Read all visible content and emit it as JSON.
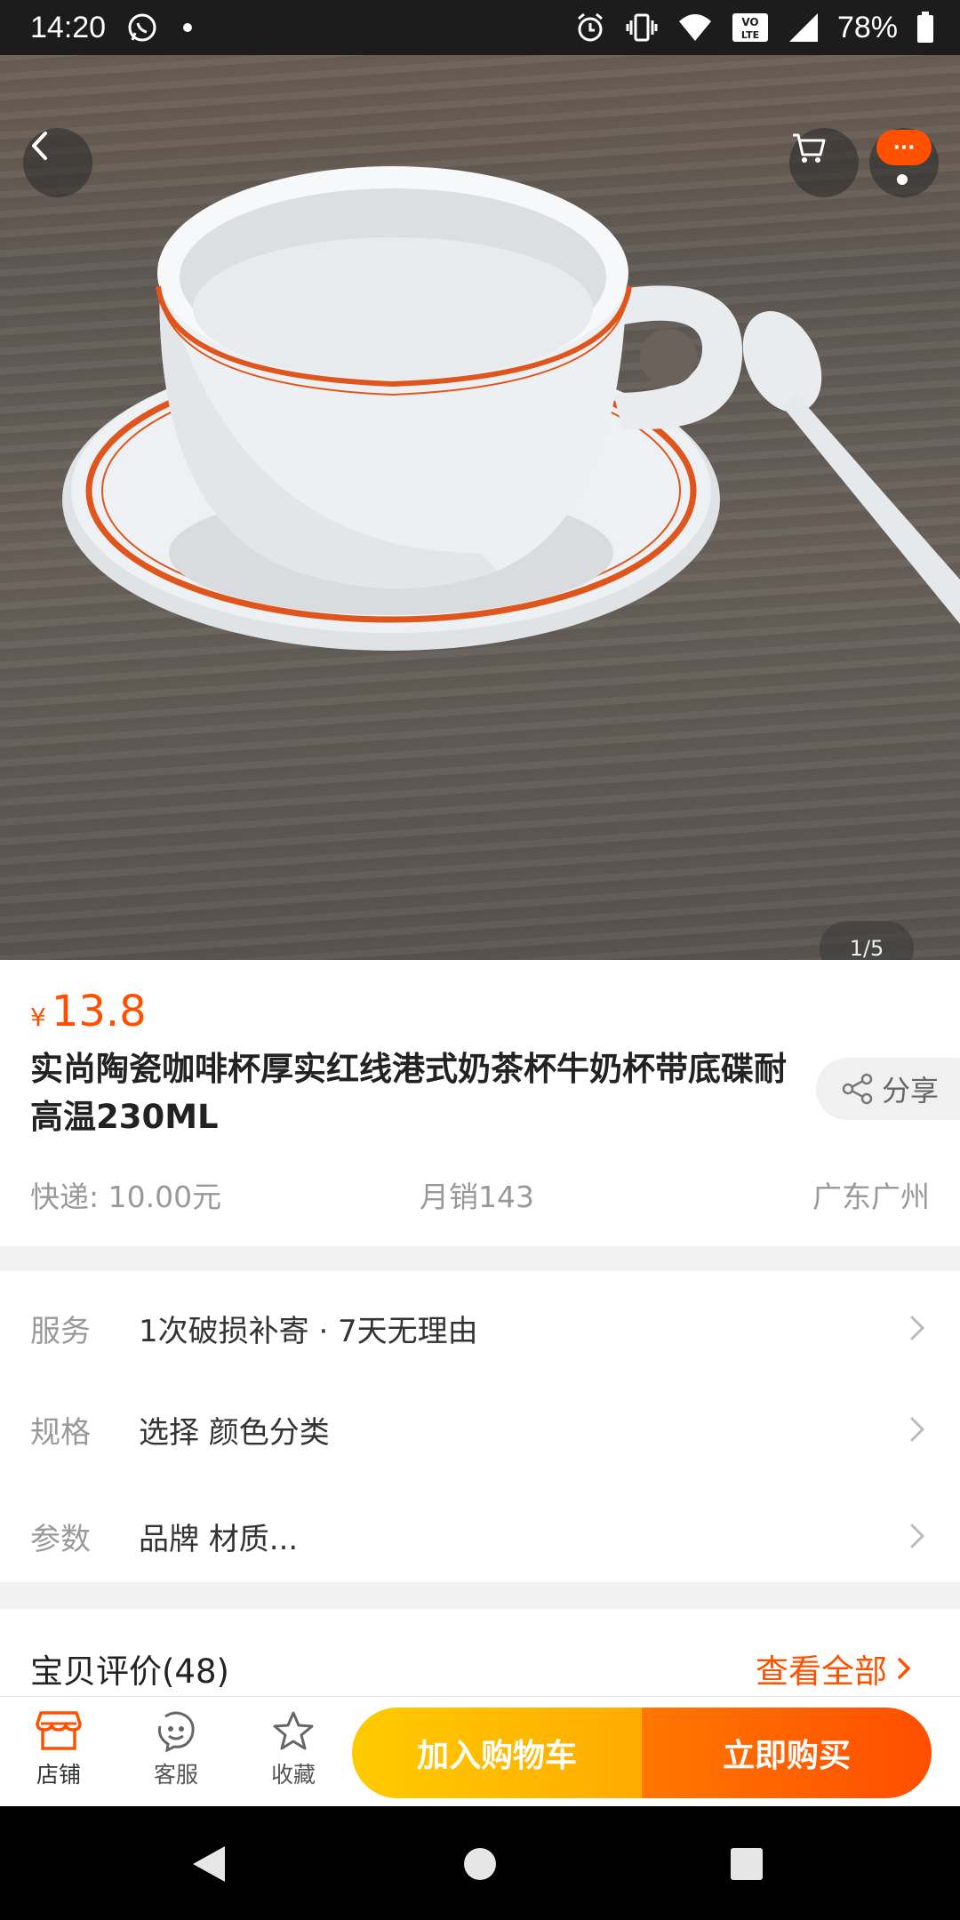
{
  "status_bar": {
    "time": "14:20",
    "battery": "78%",
    "icons": [
      "whatsapp-icon",
      "dot-icon",
      "alarm-icon",
      "vibrate-icon",
      "wifi-icon",
      "volte-icon",
      "signal-icon",
      "battery-icon"
    ]
  },
  "gallery": {
    "counter": "1/5",
    "more_badge": "···"
  },
  "product": {
    "currency": "¥",
    "price": "13.8",
    "title": "实尚陶瓷咖啡杯厚实红线港式奶茶杯牛奶杯带底碟耐高温230ML",
    "share_label": "分享",
    "shipping": "快递: 10.00元",
    "monthly_sales": "月销143",
    "location": "广东广州"
  },
  "options": [
    {
      "label": "服务",
      "value": "1次破损补寄 · 7天无理由"
    },
    {
      "label": "规格",
      "value": "选择 颜色分类"
    },
    {
      "label": "参数",
      "value": "品牌 材质..."
    }
  ],
  "reviews": {
    "title": "宝贝评价(48)",
    "view_all": "查看全部"
  },
  "bottom_bar": {
    "store": "店铺",
    "service": "客服",
    "favorite": "收藏",
    "add_to_cart": "加入购物车",
    "buy_now": "立即购买"
  },
  "colors": {
    "accent": "#ff5000",
    "cart_button": "#ffb400",
    "buy_button": "#ff5a00"
  }
}
